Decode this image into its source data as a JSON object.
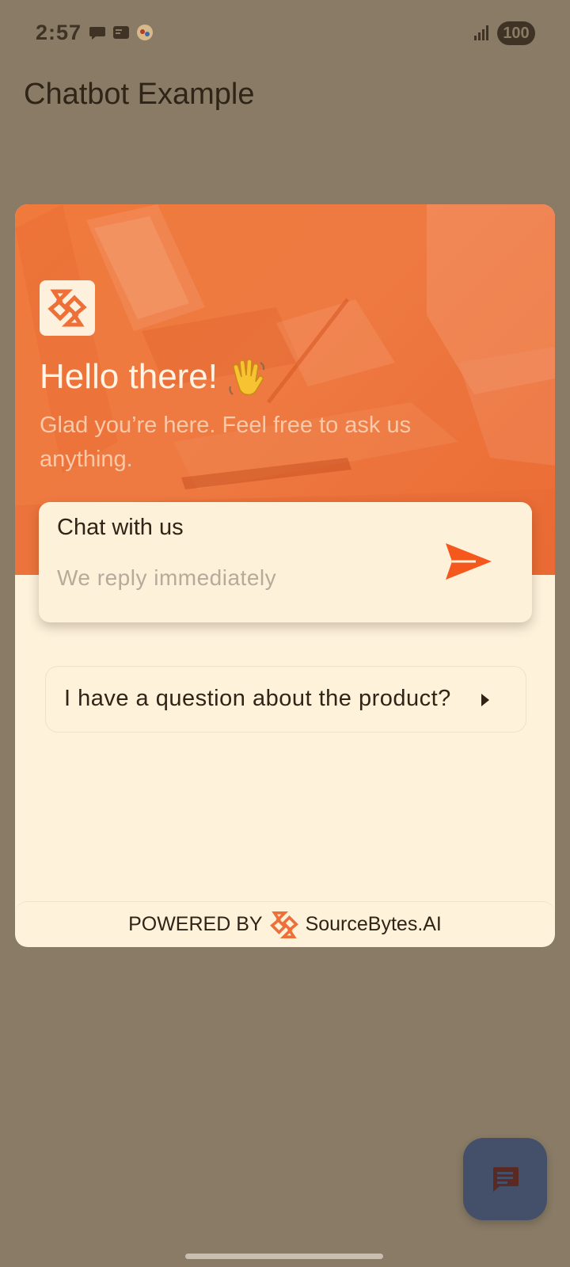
{
  "status_bar": {
    "time": "2:57",
    "battery": "100"
  },
  "app_bar": {
    "title": "Chatbot Example"
  },
  "widget": {
    "greeting": "Hello there! ",
    "greeting_emoji": "👋",
    "subtitle": "Glad you’re here. Feel free to ask us anything.",
    "chat_box": {
      "title": "Chat with us",
      "subtitle": "We reply immediately",
      "send_icon": "send-icon"
    },
    "quick_reply": {
      "label": "I have a question about the product?",
      "icon": "caret-right-icon"
    },
    "footer": {
      "powered_label": "POWERED BY",
      "brand_name": "SourceBytes.AI"
    }
  },
  "fab": {
    "icon": "chat-icon"
  },
  "colors": {
    "background_scrim": "#897b66",
    "accent_orange": "#f07a3c",
    "card_background": "#fef2db",
    "fab_background": "#44506a",
    "send_orange": "#f4581c"
  }
}
